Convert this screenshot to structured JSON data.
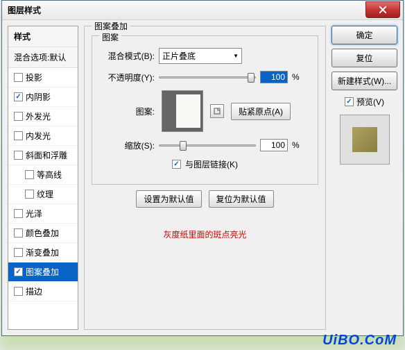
{
  "window": {
    "title": "图层样式"
  },
  "sidebar": {
    "header": "样式",
    "blending": "混合选项:默认",
    "items": [
      {
        "label": "投影",
        "checked": false
      },
      {
        "label": "内阴影",
        "checked": true
      },
      {
        "label": "外发光",
        "checked": false
      },
      {
        "label": "内发光",
        "checked": false
      },
      {
        "label": "斜面和浮雕",
        "checked": false
      },
      {
        "label": "等高线",
        "checked": false,
        "indent": true
      },
      {
        "label": "纹理",
        "checked": false,
        "indent": true
      },
      {
        "label": "光泽",
        "checked": false
      },
      {
        "label": "颜色叠加",
        "checked": false
      },
      {
        "label": "渐变叠加",
        "checked": false
      },
      {
        "label": "图案叠加",
        "checked": true,
        "selected": true
      },
      {
        "label": "描边",
        "checked": false
      }
    ]
  },
  "panel": {
    "title": "图案叠加",
    "group": "图案",
    "blend_label": "混合模式(B):",
    "blend_value": "正片叠底",
    "opacity_label": "不透明度(Y):",
    "opacity_value": "100",
    "percent": "%",
    "pattern_label": "图案:",
    "snap_btn": "贴紧原点(A)",
    "scale_label": "缩放(S):",
    "scale_value": "100",
    "link_label": "与图层链接(K)",
    "link_checked": true,
    "set_default": "设置为默认值",
    "reset_default": "复位为默认值",
    "note": "灰度纸里面的斑点亮光",
    "dropdown_icon": "▼"
  },
  "right": {
    "ok": "确定",
    "cancel": "复位",
    "new_style": "新建样式(W)...",
    "preview": "预览(V)",
    "preview_checked": true
  },
  "watermark": "UiBO.CoM"
}
